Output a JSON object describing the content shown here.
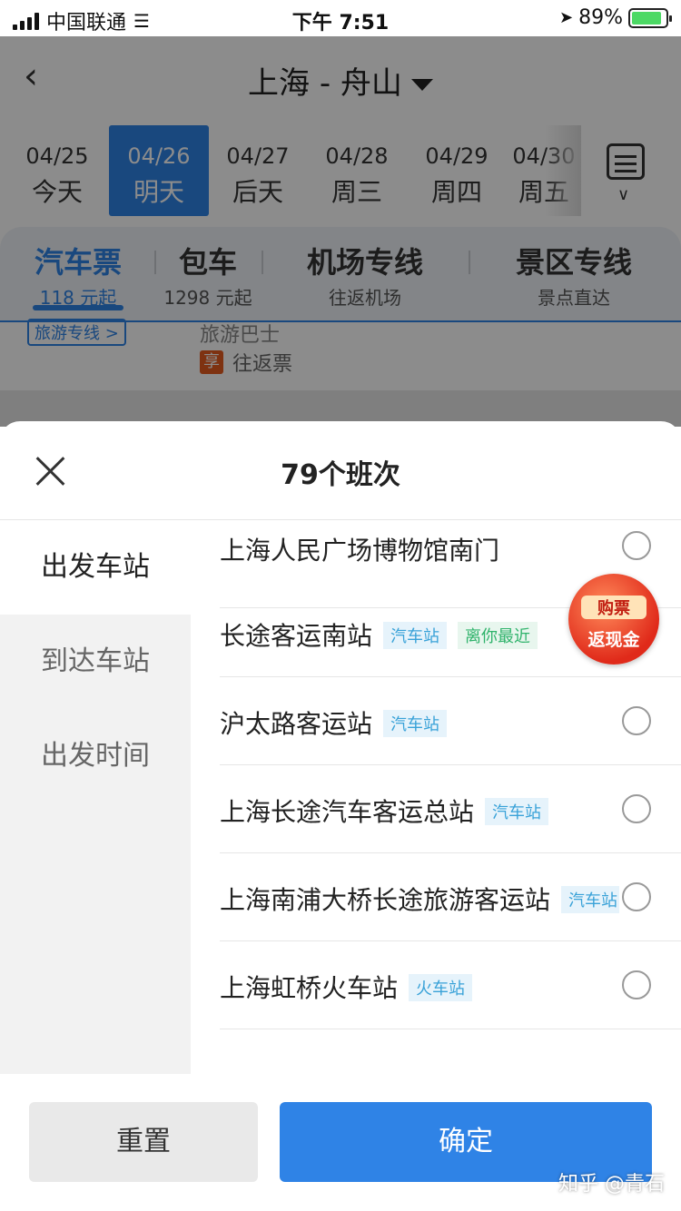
{
  "status": {
    "carrier": "中国联通",
    "time": "下午 7:51",
    "battery": "89%",
    "battery_level": 0.89
  },
  "header": {
    "title": "上海 - 舟山"
  },
  "dates": [
    {
      "date": "04/25",
      "weekday": "今天"
    },
    {
      "date": "04/26",
      "weekday": "明天",
      "selected": true
    },
    {
      "date": "04/27",
      "weekday": "后天"
    },
    {
      "date": "04/28",
      "weekday": "周三"
    },
    {
      "date": "04/29",
      "weekday": "周四"
    },
    {
      "date": "04/30",
      "weekday": "周五"
    }
  ],
  "tabs": [
    {
      "title": "汽车票",
      "sub": "118 元起",
      "active": true
    },
    {
      "title": "包车",
      "sub": "1298 元起"
    },
    {
      "title": "机场专线",
      "sub": "往返机场"
    },
    {
      "title": "景区专线",
      "sub": "景点直达"
    }
  ],
  "peek": {
    "tag": "旅游专线 >",
    "bus": "旅游巴士",
    "badge": "享",
    "roundtrip": "往返票"
  },
  "sheet": {
    "title": "79个班次",
    "sidebar": [
      "出发车站",
      "到达车站",
      "出发时间"
    ],
    "stations": [
      {
        "name": "上海人民广场博物馆南门",
        "tags": []
      },
      {
        "name": "长途客运南站",
        "tags": [
          "汽车站",
          "离你最近"
        ]
      },
      {
        "name": "沪太路客运站",
        "tags": [
          "汽车站"
        ]
      },
      {
        "name": "上海长途汽车客运总站",
        "tags": [
          "汽车站"
        ]
      },
      {
        "name": "上海南浦大桥长途旅游客运站",
        "tags": [
          "汽车站"
        ]
      },
      {
        "name": "上海虹桥火车站",
        "tags": [
          "火车站"
        ]
      }
    ],
    "promo": {
      "line1": "购票",
      "line2": "返现金"
    },
    "reset": "重置",
    "confirm": "确定"
  },
  "watermark": "知乎 @青石",
  "colors": {
    "accent": "#2f83e6",
    "tag_blue": "#39a2d8",
    "tag_green": "#2fb36b"
  }
}
